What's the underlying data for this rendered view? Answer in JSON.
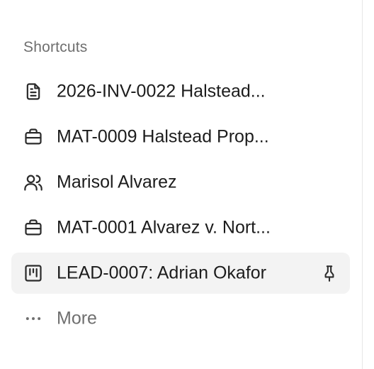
{
  "shortcuts": {
    "title": "Shortcuts",
    "items": [
      {
        "label": "2026-INV-0022 Halstead...",
        "icon": "document-icon"
      },
      {
        "label": "MAT-0009 Halstead Prop...",
        "icon": "briefcase-icon"
      },
      {
        "label": "Marisol Alvarez",
        "icon": "users-icon"
      },
      {
        "label": "MAT-0001 Alvarez v. Nort...",
        "icon": "briefcase-icon"
      },
      {
        "label": "LEAD-0007: Adrian Okafor",
        "icon": "kanban-icon",
        "active": true,
        "pinned": true
      }
    ],
    "more_label": "More",
    "more_icon": "ellipsis-icon"
  },
  "colors": {
    "active_background": "#f3f3f3",
    "muted_text": "#6f6f6f",
    "text": "#1c1c1c"
  }
}
